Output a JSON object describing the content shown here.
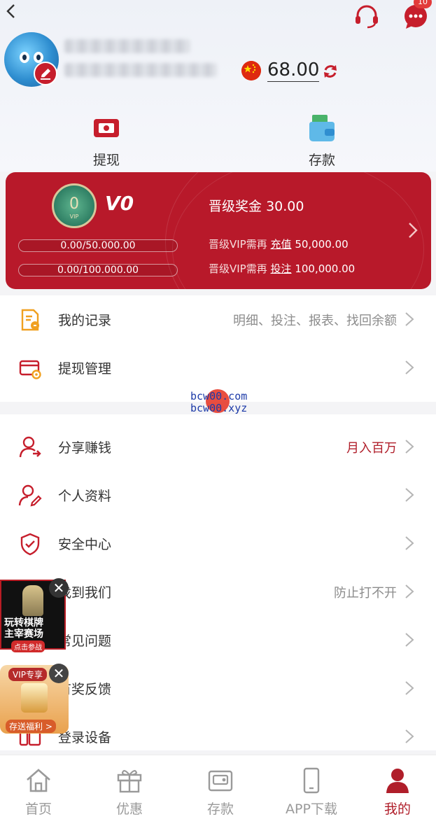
{
  "header": {
    "message_count": "10",
    "balance": "68.00"
  },
  "quick_actions": {
    "withdraw_label": "提现",
    "deposit_label": "存款"
  },
  "vip": {
    "medal_number": "0",
    "medal_tag": "VIP",
    "level": "V0",
    "progress_recharge_text": "0.00/50.000.00",
    "progress_recharge_fraction": 0,
    "progress_bet_text": "0.00/100.000.00",
    "progress_bet_fraction": 0,
    "bonus_label": "晋级奖金",
    "bonus_value": "30.00",
    "req_prefix": "晋级VIP需再",
    "req_recharge_action": "充值",
    "req_recharge_value": "50,000.00",
    "req_bet_action": "投注",
    "req_bet_value": "100,000.00"
  },
  "menu_primary": [
    {
      "label": "我的记录",
      "hint": "明细、投注、报表、找回余额"
    },
    {
      "label": "提现管理",
      "hint": ""
    }
  ],
  "watermark": {
    "line1": "bcw00.com",
    "line2": "bcw00.xyz"
  },
  "menu_secondary": [
    {
      "label": "分享赚钱",
      "hint": "月入百万"
    },
    {
      "label": "个人资料",
      "hint": ""
    },
    {
      "label": "安全中心",
      "hint": ""
    },
    {
      "label": "找到我们",
      "hint": "防止打不开"
    },
    {
      "label": "常见问题",
      "hint": ""
    },
    {
      "label": "有奖反馈",
      "hint": ""
    },
    {
      "label": "登录设备",
      "hint": ""
    }
  ],
  "ads": {
    "ad1_title": "玩转棋牌\n主宰赛场",
    "ad1_cta": "点击参战",
    "ad2_badge": "VIP专享",
    "ad2_cta": "存送福利 >",
    "close_glyph": "✕"
  },
  "tabs": [
    {
      "label": "首页",
      "active": false
    },
    {
      "label": "优惠",
      "active": false
    },
    {
      "label": "存款",
      "active": false
    },
    {
      "label": "APP下载",
      "active": false
    },
    {
      "label": "我的",
      "active": true
    }
  ],
  "colors": {
    "brand_red": "#b8192a",
    "accent_orange": "#f0a020"
  }
}
